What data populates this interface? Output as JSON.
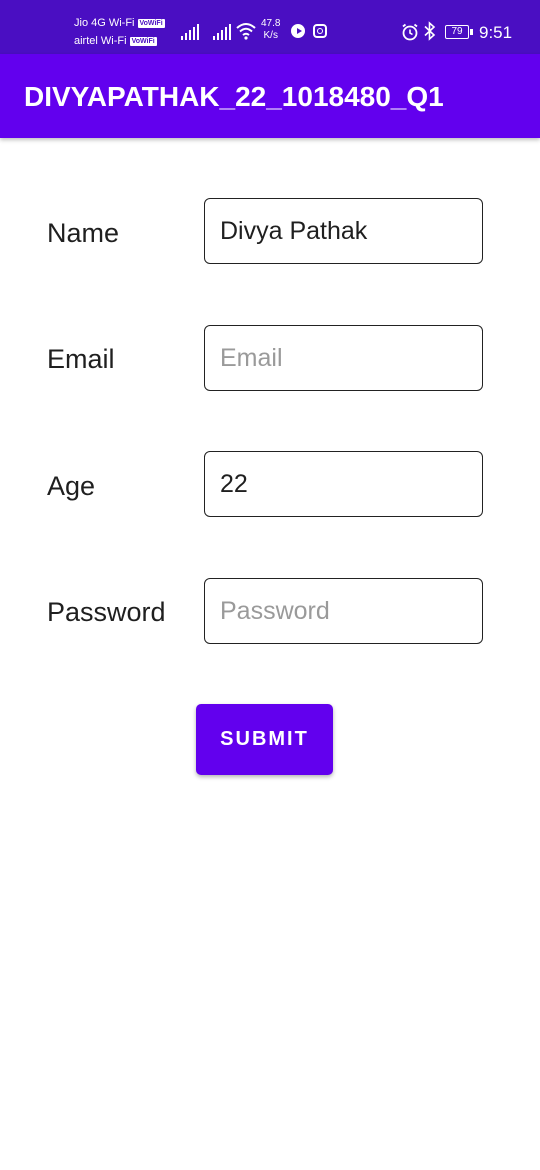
{
  "status_bar": {
    "carrier1": "Jio 4G Wi-Fi",
    "carrier2": "airtel Wi-Fi",
    "vowifi_badge": "VoWiFi",
    "speed_value": "47.8",
    "speed_unit": "K/s",
    "battery": "79",
    "time": "9:51",
    "icons": [
      "signal-icon",
      "signal-icon",
      "wifi-icon",
      "play-icon",
      "instagram-icon",
      "alarm-icon",
      "bluetooth-icon",
      "battery-icon"
    ]
  },
  "app_bar": {
    "title": "DIVYAPATHAK_22_1018480_Q1",
    "color": "#6200ee"
  },
  "form": {
    "name": {
      "label": "Name",
      "value": "Divya Pathak",
      "placeholder": ""
    },
    "email": {
      "label": "Email",
      "value": "",
      "placeholder": "Email"
    },
    "age": {
      "label": "Age",
      "value": "22",
      "placeholder": ""
    },
    "password": {
      "label": "Password",
      "value": "",
      "placeholder": "Password"
    }
  },
  "submit_label": "SUBMIT",
  "colors": {
    "status_bar": "#4a0ec2",
    "accent": "#6200ee"
  }
}
